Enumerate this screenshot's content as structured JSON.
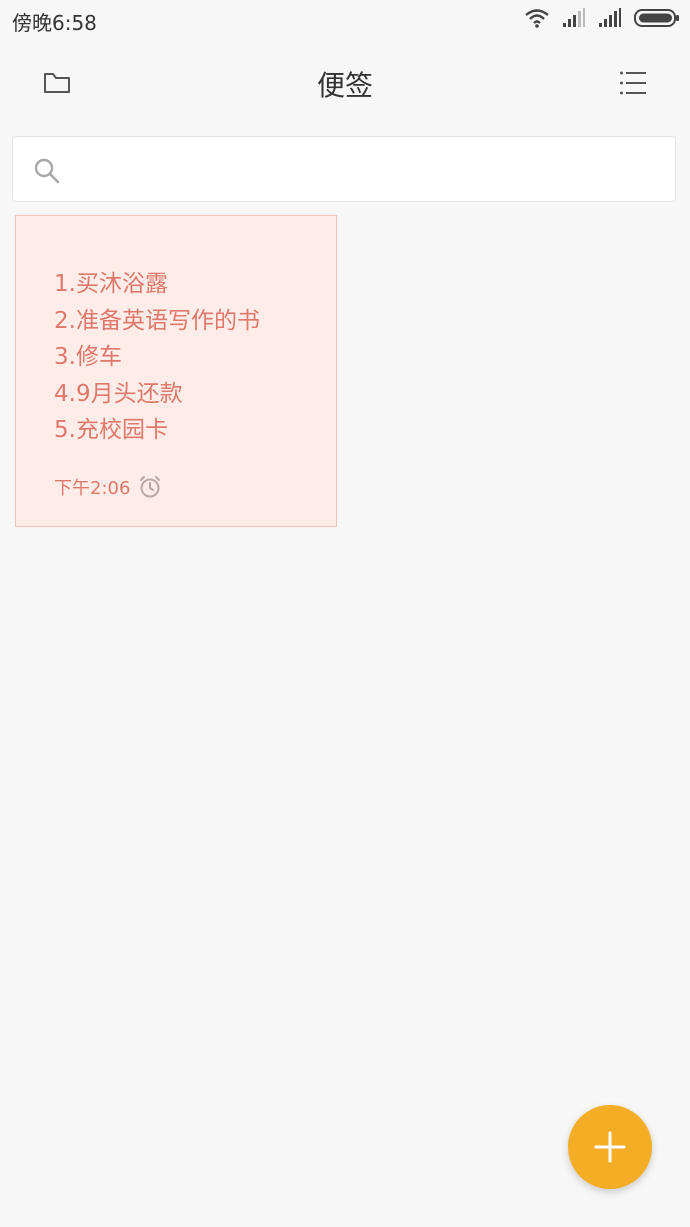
{
  "status_bar": {
    "time": "傍晚6:58"
  },
  "header": {
    "title": "便签"
  },
  "search": {
    "placeholder": ""
  },
  "notes": [
    {
      "lines": [
        "1.买沐浴露",
        "2.准备英语写作的书",
        "3.修车",
        "4.9月头还款",
        "5.充校园卡"
      ],
      "time": "下午2:06",
      "has_alarm": true
    }
  ],
  "icons": {
    "folder": "folder-icon",
    "menu": "list-menu-icon",
    "search": "search-icon",
    "alarm": "alarm-clock-icon",
    "add": "plus-icon",
    "wifi": "wifi-icon",
    "signal": "signal-icon",
    "battery": "battery-icon"
  },
  "colors": {
    "background": "#f7f7f7",
    "note_bg": "#fdece8",
    "note_border": "#f3c6ba",
    "note_text": "#e0786b",
    "fab": "#f5ad25",
    "title_text": "#333333"
  }
}
